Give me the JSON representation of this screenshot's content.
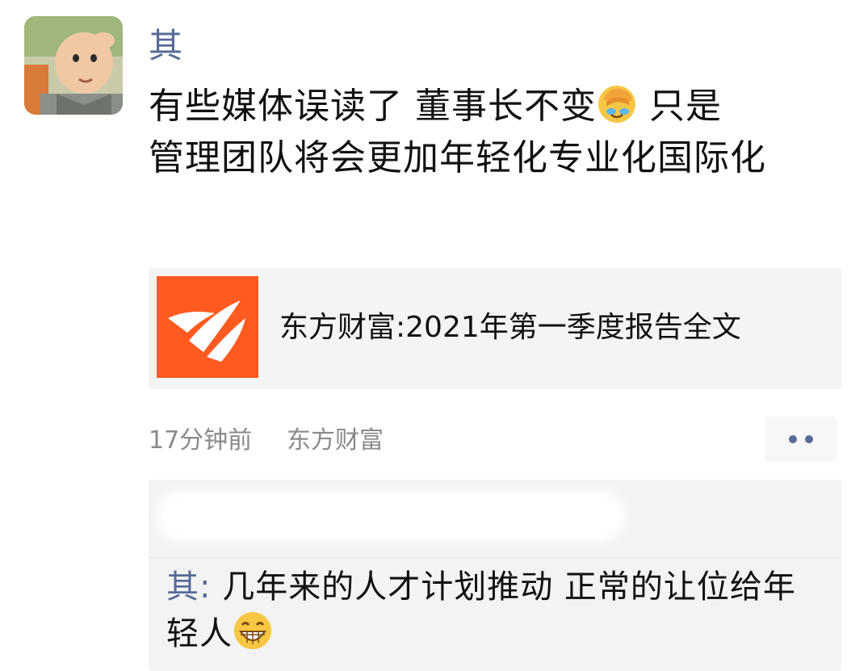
{
  "post": {
    "author": "其",
    "text_line1": "有些媒体误读了 董事长不变",
    "text_after_emoji": " 只是",
    "text_rest": "管理团队将会更加年轻化专业化国际化",
    "emoji": "facepalm-crying-emoji"
  },
  "link_card": {
    "title": "东方财富:2021年第一季度报告全文",
    "thumb_icon": "eastmoney-logo-icon",
    "brand_color": "#ff5a1f"
  },
  "meta": {
    "time": "17分钟前",
    "source": "东方财富"
  },
  "comment": {
    "author": "其",
    "separator": ": ",
    "text": "几年来的人才计划推动 正常的让位给年轻人",
    "emoji": "grinning-emoji"
  },
  "colors": {
    "name_blue": "#576b95",
    "text": "#111111",
    "meta_gray": "#8a8a8a",
    "card_bg": "#f4f4f4"
  }
}
